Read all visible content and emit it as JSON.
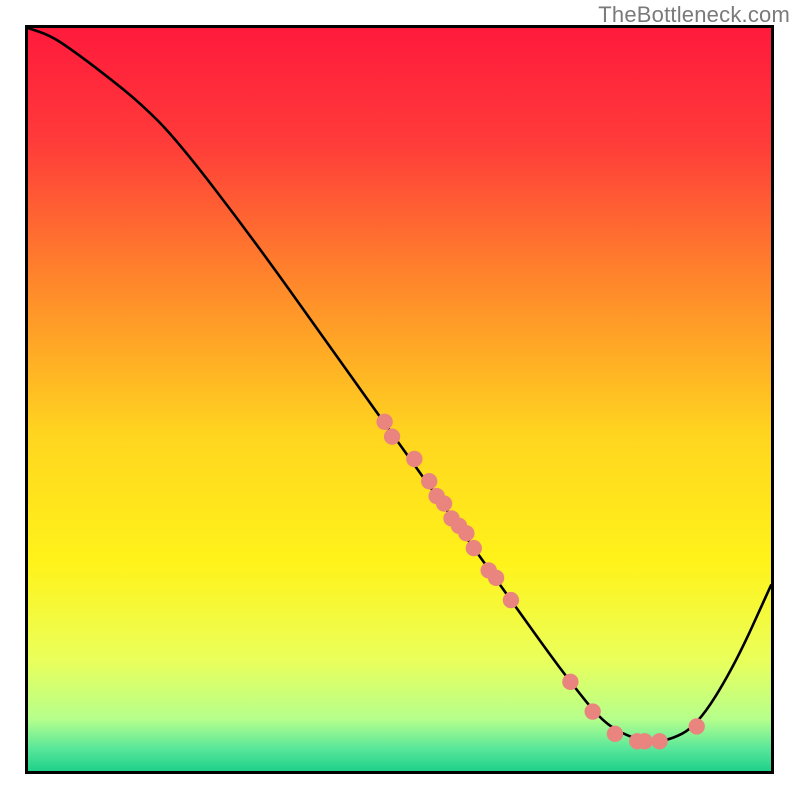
{
  "attribution": "TheBottleneck.com",
  "chart_data": {
    "type": "line",
    "title": "",
    "xlabel": "",
    "ylabel": "",
    "xlim": [
      0,
      100
    ],
    "ylim": [
      0,
      100
    ],
    "grid": false,
    "legend": false,
    "series": [
      {
        "name": "bottleneck-curve",
        "x": [
          0,
          3,
          6,
          10,
          15,
          20,
          30,
          40,
          50,
          55,
          60,
          65,
          70,
          73,
          77,
          80,
          83,
          86,
          90,
          95,
          100
        ],
        "y": [
          100,
          99,
          97,
          94,
          90,
          85,
          72,
          58,
          44,
          37,
          30,
          23,
          16,
          12,
          7,
          5,
          4,
          4,
          6,
          14,
          25
        ]
      }
    ],
    "highlight_points": {
      "name": "data-dots",
      "x": [
        48,
        49,
        52,
        54,
        55,
        56,
        57,
        58,
        59,
        60,
        62,
        63,
        65,
        73,
        76,
        79,
        82,
        83,
        85,
        90
      ],
      "y": [
        47,
        45,
        42,
        39,
        37,
        36,
        34,
        33,
        32,
        30,
        27,
        26,
        23,
        12,
        8,
        5,
        4,
        4,
        4,
        6
      ]
    },
    "gradient_stops": [
      {
        "offset": 0.0,
        "color": "#ff1a3c"
      },
      {
        "offset": 0.15,
        "color": "#ff3a3a"
      },
      {
        "offset": 0.35,
        "color": "#ff8a2a"
      },
      {
        "offset": 0.55,
        "color": "#ffd61f"
      },
      {
        "offset": 0.72,
        "color": "#fff31a"
      },
      {
        "offset": 0.85,
        "color": "#eaff5a"
      },
      {
        "offset": 0.93,
        "color": "#b6ff8c"
      },
      {
        "offset": 0.97,
        "color": "#58e79a"
      },
      {
        "offset": 1.0,
        "color": "#1fd18a"
      }
    ],
    "dot_color": "#e9857e",
    "curve_color": "#000000"
  }
}
